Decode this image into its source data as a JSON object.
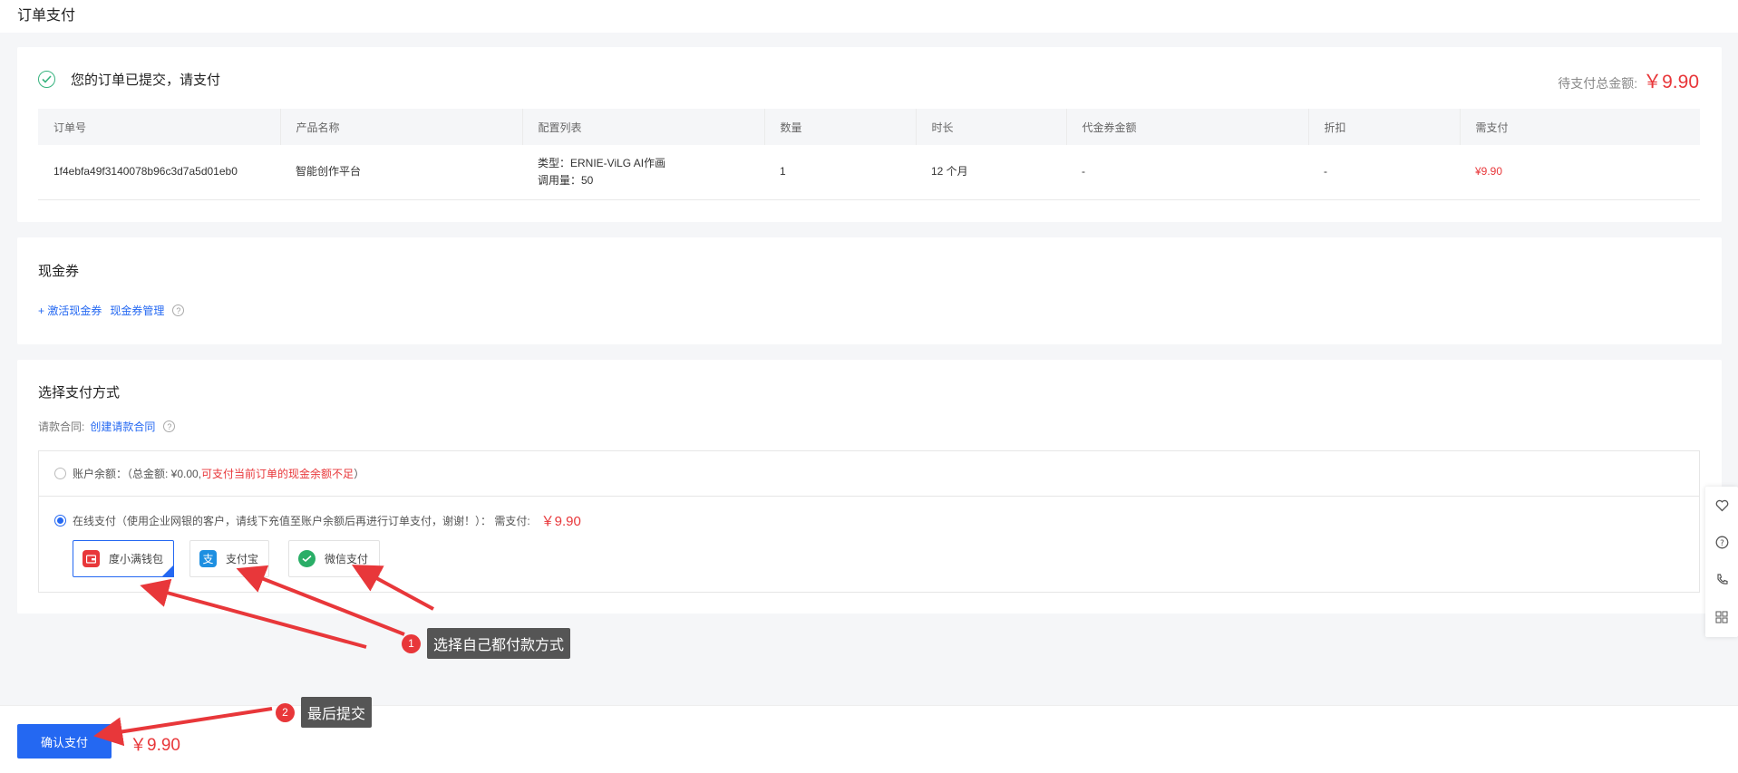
{
  "page": {
    "title": "订单支付"
  },
  "order_card": {
    "success_text": "您的订单已提交，请支付",
    "total_label": "待支付总金额:",
    "total_amount": "￥9.90",
    "headers": [
      "订单号",
      "产品名称",
      "配置列表",
      "数量",
      "时长",
      "代金券金额",
      "折扣",
      "需支付"
    ],
    "row": {
      "order_id": "1f4ebfa49f3140078b96c3d7a5d01eb0",
      "product": "智能创作平台",
      "config_line1": "类型：ERNIE-ViLG AI作画",
      "config_line2": "调用量：50",
      "quantity": "1",
      "duration": "12 个月",
      "coupon": "-",
      "discount": "-",
      "pay": "¥9.90"
    }
  },
  "coupon_card": {
    "title": "现金券",
    "activate_link": "+ 激活现金券",
    "manage_link": "现金券管理"
  },
  "payment_card": {
    "title": "选择支付方式",
    "contract_label": "请款合同:",
    "contract_link": "创建请款合同",
    "balance_option": {
      "label": "账户余额：（总金额: ¥0.00,",
      "warning": "可支付当前订单的现金余额不足",
      "suffix": "）"
    },
    "online_option": {
      "label": "在线支付（使用企业网银的客户，请线下充值至账户余额后再进行订单支付，谢谢！）： 需支付:",
      "amount": "￥9.90"
    },
    "methods": [
      {
        "name": "度小满钱包",
        "icon": "duxiaoman-wallet-icon",
        "color": "#e8373a",
        "selected": true
      },
      {
        "name": "支付宝",
        "icon": "alipay-icon",
        "color": "#1d8fe1",
        "selected": false
      },
      {
        "name": "微信支付",
        "icon": "wechat-pay-icon",
        "color": "#2aae67",
        "selected": false
      }
    ]
  },
  "bottom_bar": {
    "confirm_label": "确认支付",
    "amount": "￥9.90"
  },
  "annotations": [
    {
      "number": "1",
      "text": "选择自己都付款方式"
    },
    {
      "number": "2",
      "text": "最后提交"
    }
  ],
  "float_panel": {
    "items": [
      "favorite-icon",
      "help-icon",
      "phone-icon",
      "grid-icon"
    ]
  }
}
